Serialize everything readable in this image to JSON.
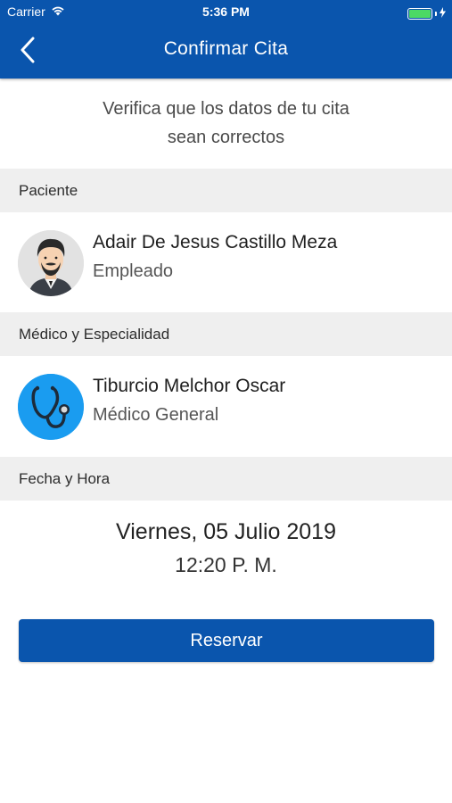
{
  "status_bar": {
    "carrier": "Carrier",
    "time": "5:36 PM",
    "wifi_icon": "wifi-icon",
    "battery_icon": "battery-icon",
    "charging_icon": "bolt-icon"
  },
  "nav": {
    "title": "Confirmar Cita",
    "back_icon": "chevron-left-icon"
  },
  "intro": {
    "line1": "Verifica que los datos de tu cita",
    "line2": "sean correctos"
  },
  "sections": {
    "patient": {
      "header": "Paciente",
      "name": "Adair De Jesus Castillo Meza",
      "role": "Empleado",
      "avatar_icon": "person-avatar-icon"
    },
    "doctor": {
      "header": "Médico y Especialidad",
      "name": "Tiburcio Melchor Oscar",
      "specialty": "Médico General",
      "avatar_icon": "stethoscope-icon"
    },
    "datetime": {
      "header": "Fecha y Hora",
      "date": "Viernes, 05 Julio 2019",
      "time": "12:20 P. M."
    }
  },
  "actions": {
    "reserve_label": "Reservar"
  },
  "colors": {
    "primary": "#0a55ad",
    "section_bg": "#efefef",
    "doctor_avatar_bg": "#1a9cf0",
    "battery": "#4cd964"
  }
}
